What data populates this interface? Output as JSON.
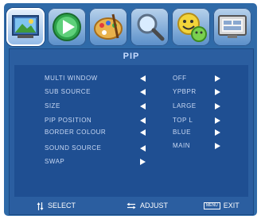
{
  "icons": [
    {
      "name": "picture-icon",
      "active": true
    },
    {
      "name": "play-icon",
      "active": false
    },
    {
      "name": "palette-icon",
      "active": false
    },
    {
      "name": "magnifier-icon",
      "active": false
    },
    {
      "name": "smiley-icon",
      "active": false
    },
    {
      "name": "monitor-icon",
      "active": false
    }
  ],
  "menu": {
    "title": "PIP",
    "rows": [
      {
        "label": "MULTI WINDOW",
        "value": "OFF",
        "left_arrow": true,
        "right_arrow": true
      },
      {
        "label": "SUB SOURCE",
        "value": "YPBPR",
        "left_arrow": true,
        "right_arrow": true
      },
      {
        "label": "SIZE",
        "value": "LARGE",
        "left_arrow": true,
        "right_arrow": true
      },
      {
        "label": "PIP POSITION",
        "value": "TOP L",
        "left_arrow": true,
        "right_arrow": true
      },
      {
        "label": "BORDER COLOUR",
        "value": "BLUE",
        "left_arrow": true,
        "right_arrow": true
      },
      {
        "label": "SOUND SOURCE",
        "value": "MAIN",
        "left_arrow": true,
        "right_arrow": true
      },
      {
        "label": "SWAP",
        "value": "",
        "left_arrow": false,
        "right_arrow": true
      }
    ]
  },
  "footer": {
    "select": "SELECT",
    "adjust": "ADJUST",
    "menu_key": "MENU",
    "exit": "EXIT"
  },
  "colors": {
    "frame": "#2f6aa8",
    "panel": "#2b5ea0",
    "content": "#1f4f92",
    "text": "#c9d9f4",
    "title": "#c8dcff"
  }
}
